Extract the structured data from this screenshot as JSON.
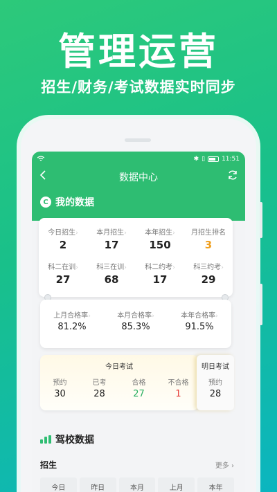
{
  "hero": {
    "title": "管理运营",
    "subtitle": "招生/财务/考试数据实时同步"
  },
  "status_bar": {
    "time": "11:51",
    "icons": [
      "wifi-icon",
      "bluetooth-icon",
      "vibrate-icon",
      "battery-icon"
    ]
  },
  "nav": {
    "title": "数据中心",
    "back_icon": "chevron-left-icon",
    "refresh_icon": "refresh-icon"
  },
  "my_data": {
    "label": "我的数据",
    "stats_row1": [
      {
        "label": "今日招生",
        "value": "2"
      },
      {
        "label": "本月招生",
        "value": "17"
      },
      {
        "label": "本年招生",
        "value": "150"
      },
      {
        "label": "月招生排名",
        "value": "3"
      }
    ],
    "stats_row2": [
      {
        "label": "科二在训",
        "value": "27"
      },
      {
        "label": "科三在训",
        "value": "68"
      },
      {
        "label": "科二约考",
        "value": "17"
      },
      {
        "label": "科三约考",
        "value": "29"
      }
    ],
    "pass_rates": [
      {
        "label": "上月合格率",
        "value": "81.2%"
      },
      {
        "label": "本月合格率",
        "value": "85.3%"
      },
      {
        "label": "本年合格率",
        "value": "91.5%"
      }
    ]
  },
  "today_exam": {
    "title": "今日考试",
    "items": [
      {
        "label": "预约",
        "value": "30"
      },
      {
        "label": "已考",
        "value": "28"
      },
      {
        "label": "合格",
        "value": "27"
      },
      {
        "label": "不合格",
        "value": "1"
      }
    ]
  },
  "tomorrow_exam": {
    "title": "明日考试",
    "items": [
      {
        "label": "预约",
        "value": "28"
      }
    ]
  },
  "school_data": {
    "label": "驾校数据",
    "enroll_label": "招生",
    "more_label": "更多",
    "tabs": [
      "今日",
      "昨日",
      "本月",
      "上月",
      "本年"
    ]
  },
  "colors": {
    "brand_green": "#2ebd72",
    "rank_orange": "#f0a020",
    "pass_green": "#27ae60",
    "fail_red": "#e53935"
  }
}
